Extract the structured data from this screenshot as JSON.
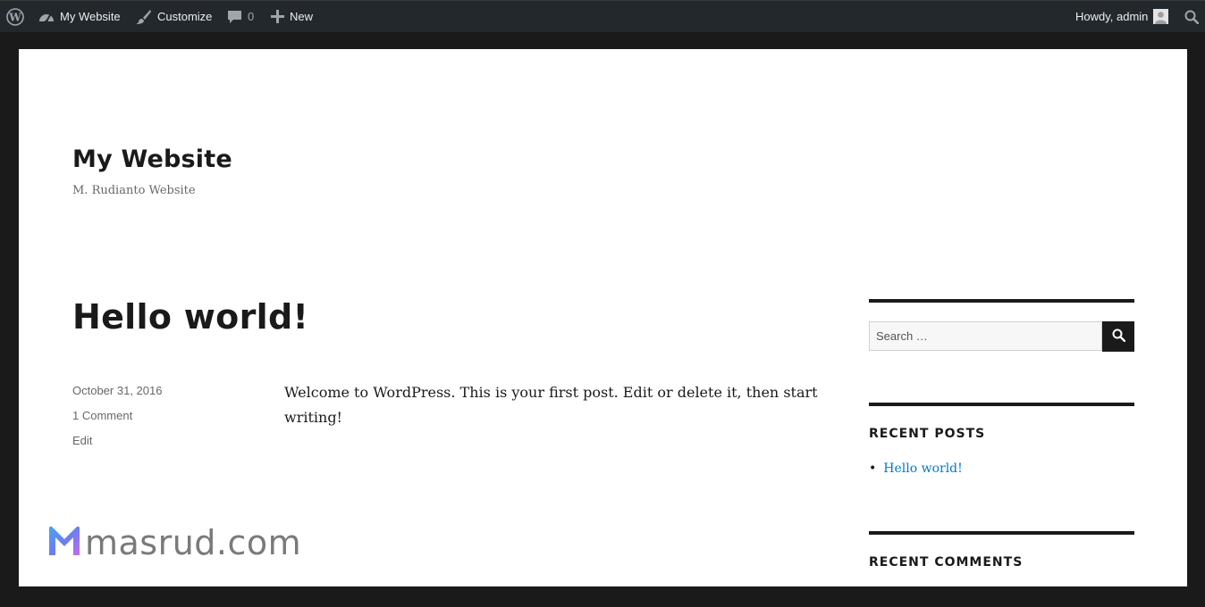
{
  "admin_bar": {
    "wp_logo_icon": "wordpress-logo-icon",
    "site_name": "My Website",
    "customize": "Customize",
    "comments_count": "0",
    "new_label": "New",
    "howdy": "Howdy, admin",
    "search_icon": "search-icon"
  },
  "site": {
    "title": "My Website",
    "description": "M. Rudianto Website"
  },
  "post": {
    "title": "Hello world!",
    "date": "October 31, 2016",
    "comments": "1 Comment",
    "edit": "Edit",
    "content": "Welcome to WordPress. This is your first post. Edit or delete it, then start writing!"
  },
  "sidebar": {
    "search_placeholder": "Search …",
    "recent_posts_title": "RECENT POSTS",
    "recent_posts": [
      "Hello world!"
    ],
    "recent_comments_title": "RECENT COMMENTS"
  },
  "watermark": {
    "text": "masrud.com"
  },
  "colors": {
    "admin_bar_bg": "#23282d",
    "frame_bg": "#1a1a1a",
    "link": "#007acc",
    "watermark_m_gradient": [
      "#5b8def",
      "#b86ee6"
    ]
  }
}
